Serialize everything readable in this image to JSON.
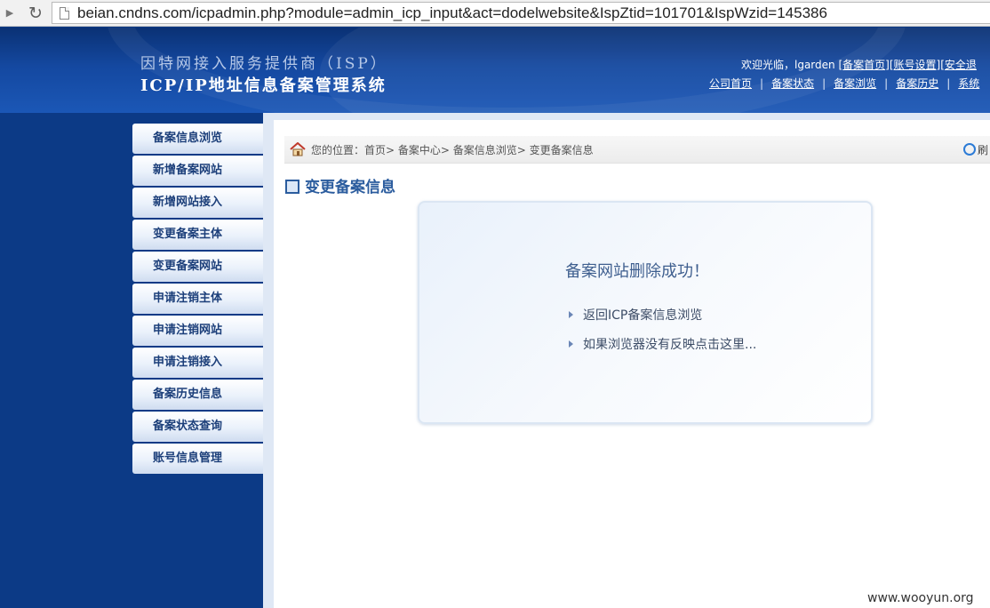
{
  "browser": {
    "url": "beian.cndns.com/icpadmin.php?module=admin_icp_input&act=dodelwebsite&IspZtid=101701&IspWzid=145386"
  },
  "header": {
    "subtitle": "因特网接入服务提供商（ISP）",
    "title": "ICP/IP地址信息备案管理系统",
    "welcome_prefix": "欢迎光临，lgarden [",
    "links": {
      "home": "备案首页",
      "account": "账号设置",
      "logout": "安全退"
    },
    "nav": [
      "公司首页",
      "备案状态",
      "备案浏览",
      "备案历史",
      "系统"
    ]
  },
  "sidebar": {
    "items": [
      "备案信息浏览",
      "新增备案网站",
      "新增网站接入",
      "变更备案主体",
      "变更备案网站",
      "申请注销主体",
      "申请注销网站",
      "申请注销接入",
      "备案历史信息",
      "备案状态查询",
      "账号信息管理"
    ]
  },
  "main": {
    "breadcrumb": "您的位置：首页> 备案中心> 备案信息浏览> 变更备案信息",
    "refresh_label": "刷",
    "section_title": "变更备案信息",
    "message": {
      "title": "备案网站删除成功！",
      "links": [
        "返回ICP备案信息浏览",
        "如果浏览器没有反映点击这里..."
      ]
    }
  },
  "watermark": "www.wooyun.org"
}
